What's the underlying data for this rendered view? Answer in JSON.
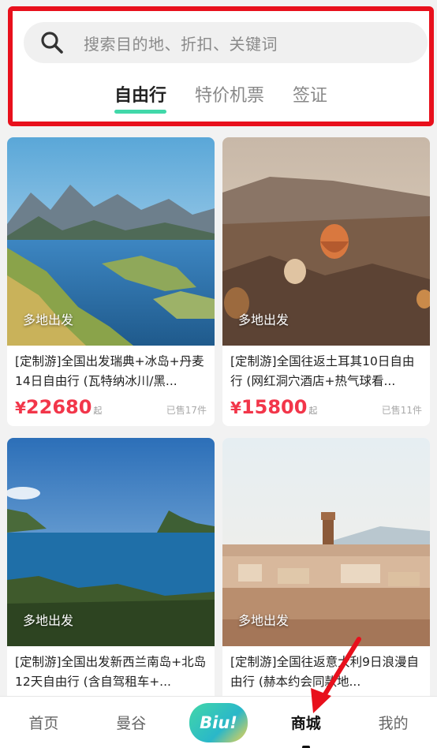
{
  "search": {
    "placeholder": "搜索目的地、折扣、关键词"
  },
  "tabs": [
    {
      "label": "自由行",
      "active": true
    },
    {
      "label": "特价机票",
      "active": false
    },
    {
      "label": "签证",
      "active": false
    }
  ],
  "products": [
    {
      "tag": "多地出发",
      "title": "[定制游]全国出发瑞典+冰岛+丹麦14日自由行 (瓦特纳冰川/黑...",
      "currency": "¥",
      "price": "22680",
      "price_suffix": "起",
      "sold": "已售17件"
    },
    {
      "tag": "多地出发",
      "title": "[定制游]全国往返土耳其10日自由行 (网红洞穴酒店+热气球看...",
      "currency": "¥",
      "price": "15800",
      "price_suffix": "起",
      "sold": "已售11件"
    },
    {
      "tag": "多地出发",
      "title": "[定制游]全国出发新西兰南岛+北岛12天自由行 (含自驾租车+...",
      "currency": "",
      "price": "",
      "price_suffix": "",
      "sold": ""
    },
    {
      "tag": "多地出发",
      "title": "[定制游]全国往返意大利9日浪漫自由行 (赫本约会同款地...",
      "currency": "",
      "price": "",
      "price_suffix": "",
      "sold": ""
    }
  ],
  "nav": [
    {
      "label": "首页",
      "active": false
    },
    {
      "label": "曼谷",
      "active": false
    },
    {
      "label": "Biu!",
      "active": false
    },
    {
      "label": "商城",
      "active": true
    },
    {
      "label": "我的",
      "active": false
    }
  ],
  "colors": {
    "annotation_red": "#e8101c",
    "accent_green": "#41d8a9",
    "price_red": "#f2364a"
  }
}
